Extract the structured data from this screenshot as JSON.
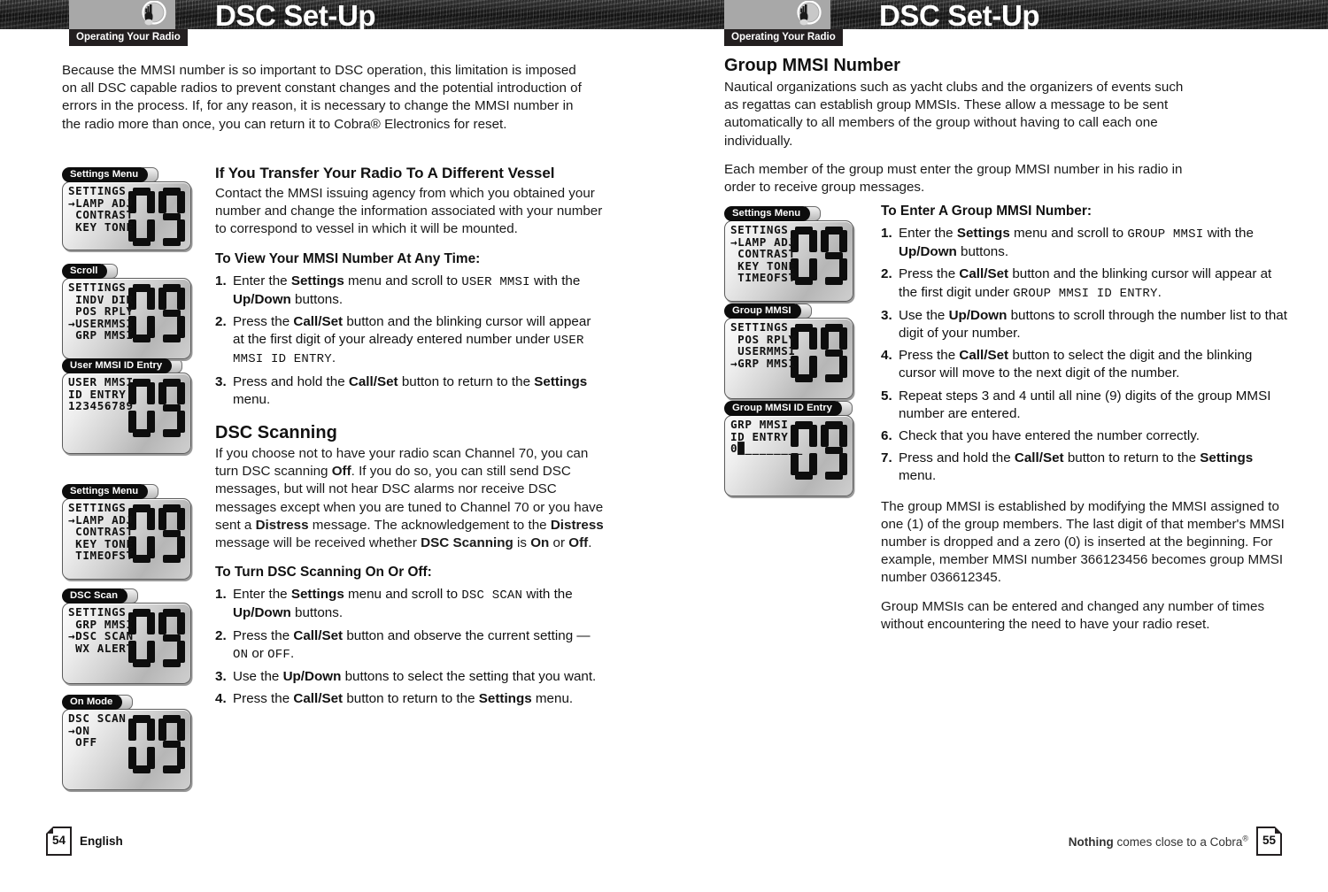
{
  "header": {
    "left": {
      "section_label": "Operating Your Radio",
      "title": "DSC Set-Up",
      "logo_icon": "radio-microphone-icon"
    },
    "right": {
      "section_label": "Operating Your Radio",
      "title": "DSC Set-Up",
      "logo_icon": "radio-microphone-icon"
    }
  },
  "left_page": {
    "intro": "Because the MMSI number is so important to DSC operation, this limitation is imposed on all DSC capable radios to prevent constant changes and the potential introduction of errors in the process. If, for any reason, it is necessary to change the MMSI number in the radio more than once, you can return it to Cobra® Electronics for reset.",
    "transfer_heading": "If You Transfer Your Radio To A Different Vessel",
    "transfer_body": "Contact the MMSI issuing agency from which you obtained your number and change the information associated with your number to correspond to vessel in which it will be mounted.",
    "view_heading": "To View Your MMSI Number At Any Time:",
    "view_steps": [
      {
        "num": "1.",
        "parts": [
          {
            "t": "Enter the ",
            "s": "n"
          },
          {
            "t": "Settings",
            "s": "b"
          },
          {
            "t": " menu and scroll to ",
            "s": "n"
          },
          {
            "t": "USER MMSI",
            "s": "m"
          },
          {
            "t": " with the ",
            "s": "n"
          },
          {
            "t": "Up/Down",
            "s": "b"
          },
          {
            "t": " buttons.",
            "s": "n"
          }
        ]
      },
      {
        "num": "2.",
        "parts": [
          {
            "t": "Press the ",
            "s": "n"
          },
          {
            "t": "Call/Set",
            "s": "b"
          },
          {
            "t": " button and the blinking cursor will appear at the first digit of your already entered number under ",
            "s": "n"
          },
          {
            "t": "USER MMSI ID ENTRY",
            "s": "m"
          },
          {
            "t": ".",
            "s": "n"
          }
        ]
      },
      {
        "num": "3.",
        "parts": [
          {
            "t": "Press and hold the ",
            "s": "n"
          },
          {
            "t": "Call/Set",
            "s": "b"
          },
          {
            "t": " button to return to the ",
            "s": "n"
          },
          {
            "t": "Settings",
            "s": "b"
          },
          {
            "t": " menu.",
            "s": "n"
          }
        ]
      }
    ],
    "scanning_heading": "DSC Scanning",
    "scanning_body_parts": [
      {
        "t": "If you choose not to have your radio scan Channel 70, you can turn DSC scanning ",
        "s": "n"
      },
      {
        "t": "Off",
        "s": "b"
      },
      {
        "t": ". If you do so, you can still send DSC messages, but will not hear DSC alarms nor receive DSC messages except when you are tuned to Channel 70 or you have sent a ",
        "s": "n"
      },
      {
        "t": "Distress",
        "s": "b"
      },
      {
        "t": " message. The acknowledgement to the ",
        "s": "n"
      },
      {
        "t": "Distress",
        "s": "b"
      },
      {
        "t": " message will be received whether ",
        "s": "n"
      },
      {
        "t": "DSC Scanning",
        "s": "b"
      },
      {
        "t": " is ",
        "s": "n"
      },
      {
        "t": "On",
        "s": "b"
      },
      {
        "t": " or ",
        "s": "n"
      },
      {
        "t": "Off",
        "s": "b"
      },
      {
        "t": ".",
        "s": "n"
      }
    ],
    "turn_heading": "To Turn DSC Scanning On Or Off:",
    "turn_steps": [
      {
        "num": "1.",
        "parts": [
          {
            "t": "Enter the ",
            "s": "n"
          },
          {
            "t": "Settings",
            "s": "b"
          },
          {
            "t": " menu and scroll to ",
            "s": "n"
          },
          {
            "t": "DSC SCAN",
            "s": "m"
          },
          {
            "t": " with the ",
            "s": "n"
          },
          {
            "t": "Up/Down",
            "s": "b"
          },
          {
            "t": " buttons.",
            "s": "n"
          }
        ]
      },
      {
        "num": "2.",
        "parts": [
          {
            "t": "Press the ",
            "s": "n"
          },
          {
            "t": "Call/Set",
            "s": "b"
          },
          {
            "t": " button and observe the current setting — ",
            "s": "n"
          },
          {
            "t": "ON",
            "s": "m"
          },
          {
            "t": " or ",
            "s": "n"
          },
          {
            "t": "OFF",
            "s": "m"
          },
          {
            "t": ".",
            "s": "n"
          }
        ]
      },
      {
        "num": "3.",
        "parts": [
          {
            "t": "Use the ",
            "s": "n"
          },
          {
            "t": "Up/Down",
            "s": "b"
          },
          {
            "t": " buttons to select the setting that you want.",
            "s": "n"
          }
        ]
      },
      {
        "num": "4.",
        "parts": [
          {
            "t": "Press the ",
            "s": "n"
          },
          {
            "t": "Call/Set",
            "s": "b"
          },
          {
            "t": " button to return to the ",
            "s": "n"
          },
          {
            "t": "Settings",
            "s": "b"
          },
          {
            "t": " menu.",
            "s": "n"
          }
        ]
      }
    ],
    "lcds": [
      {
        "label": "Settings Menu",
        "lines": [
          "SETTINGS",
          "→LAMP ADJ",
          " CONTRAST",
          " KEY TONE"
        ],
        "digits": "09",
        "tall": false
      },
      {
        "label": "Scroll",
        "lines": [
          "SETTINGS",
          " INDV DIR",
          " POS RPLY",
          "→USERMMSI",
          " GRP MMSI"
        ],
        "digits": "09",
        "tall": true
      },
      {
        "label": "User MMSI ID Entry",
        "lines": [
          "USER MMSI",
          "ID ENTRY",
          "123456789"
        ],
        "digits": "09",
        "tall": true
      },
      {
        "label": "Settings Menu",
        "lines": [
          "SETTINGS",
          "→LAMP ADJ",
          " CONTRAST",
          " KEY TONE",
          " TIMEOFST"
        ],
        "digits": "09",
        "tall": true
      },
      {
        "label": "DSC Scan",
        "lines": [
          "SETTINGS",
          " GRP MMSI",
          "→DSC SCAN",
          " WX ALERT"
        ],
        "digits": "09",
        "tall": true
      },
      {
        "label": "On Mode",
        "lines": [
          "DSC SCAN",
          "→ON",
          " OFF"
        ],
        "digits": "09",
        "tall": true
      }
    ]
  },
  "right_page": {
    "group_heading": "Group MMSI Number",
    "group_p1": "Nautical organizations such as yacht clubs and the organizers of events such as regattas can establish group MMSIs. These allow a message to be sent automatically to all members of the group without having to call each one individually.",
    "group_p2": "Each member of the group must enter the group MMSI number in his radio in order to receive group messages.",
    "enter_heading": "To Enter A Group MMSI Number:",
    "enter_steps": [
      {
        "num": "1.",
        "parts": [
          {
            "t": "Enter the ",
            "s": "n"
          },
          {
            "t": "Settings",
            "s": "b"
          },
          {
            "t": " menu and scroll to ",
            "s": "n"
          },
          {
            "t": "GROUP MMSI",
            "s": "m"
          },
          {
            "t": " with the ",
            "s": "n"
          },
          {
            "t": "Up/Down",
            "s": "b"
          },
          {
            "t": " buttons.",
            "s": "n"
          }
        ]
      },
      {
        "num": "2.",
        "parts": [
          {
            "t": "Press the ",
            "s": "n"
          },
          {
            "t": "Call/Set",
            "s": "b"
          },
          {
            "t": " button and the blinking cursor will appear at the first digit under ",
            "s": "n"
          },
          {
            "t": "GROUP MMSI ID ENTRY",
            "s": "m"
          },
          {
            "t": ".",
            "s": "n"
          }
        ]
      },
      {
        "num": "3.",
        "parts": [
          {
            "t": "Use the ",
            "s": "n"
          },
          {
            "t": "Up/Down",
            "s": "b"
          },
          {
            "t": " buttons to scroll through the number list to that digit of your number.",
            "s": "n"
          }
        ]
      },
      {
        "num": "4.",
        "parts": [
          {
            "t": "Press the ",
            "s": "n"
          },
          {
            "t": "Call/Set",
            "s": "b"
          },
          {
            "t": " button to select the digit and the blinking cursor will move to the next digit of the number.",
            "s": "n"
          }
        ]
      },
      {
        "num": "5.",
        "parts": [
          {
            "t": "Repeat steps 3 and 4 until all nine (9) digits of the group MMSI number are entered.",
            "s": "n"
          }
        ]
      },
      {
        "num": "6.",
        "parts": [
          {
            "t": "Check that you have entered the number correctly.",
            "s": "n"
          }
        ]
      },
      {
        "num": "7.",
        "parts": [
          {
            "t": "Press and hold the ",
            "s": "n"
          },
          {
            "t": "Call/Set",
            "s": "b"
          },
          {
            "t": " button to return to the ",
            "s": "n"
          },
          {
            "t": "Settings",
            "s": "b"
          },
          {
            "t": " menu.",
            "s": "n"
          }
        ]
      }
    ],
    "group_p3": "The group MMSI is established by modifying the MMSI assigned to one (1) of the group members. The last digit of that member's MMSI number is dropped and a zero (0) is inserted at the beginning. For example, member MMSI number 366123456 becomes group MMSI number 036612345.",
    "group_p4": "Group MMSIs can be entered and changed any number of times without encountering the need to have your radio reset.",
    "lcds": [
      {
        "label": "Settings Menu",
        "lines": [
          "SETTINGS",
          "→LAMP ADJ",
          " CONTRAST",
          " KEY TONE",
          " TIMEOFST"
        ],
        "digits": "09",
        "tall": true
      },
      {
        "label": "Group MMSI",
        "lines": [
          "SETTINGS",
          " POS RPLY",
          " USERMMSI",
          "→GRP MMSI"
        ],
        "digits": "09",
        "tall": true
      },
      {
        "label": "Group MMSI ID Entry",
        "lines": [
          "GRP MMSI",
          "ID ENTRY",
          "0█________"
        ],
        "digits": "09",
        "tall": true
      }
    ]
  },
  "footer": {
    "left": {
      "page": "54",
      "label": "English"
    },
    "right": {
      "tagline_bold": "Nothing",
      "tagline_rest": " comes close to a Cobra",
      "sup": "®",
      "page": "55"
    }
  }
}
